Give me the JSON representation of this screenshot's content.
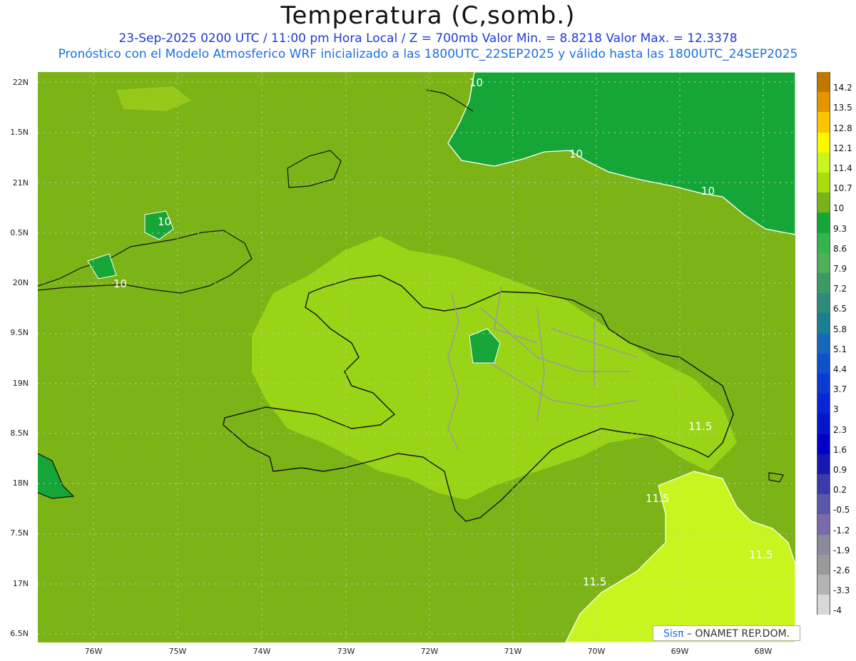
{
  "header": {
    "title": "Temperatura (C,somb.)",
    "line1": "23-Sep-2025  0200 UTC / 11:00 pm Hora Local / Z = 700mb    Valor Min. = 8.8218  Valor Max. = 12.3378",
    "line2": "Pronóstico con el Modelo Atmosferico WRF inicializado a las 1800UTC_22SEP2025 y válido hasta las  1800UTC_24SEP2025"
  },
  "axes": {
    "lat_labels": [
      "22N",
      "1.5N",
      "21N",
      "0.5N",
      "20N",
      "9.5N",
      "19N",
      "8.5N",
      "18N",
      "7.5N",
      "17N",
      "6.5N"
    ],
    "lon_labels": [
      "76W",
      "75W",
      "74W",
      "73W",
      "72W",
      "71W",
      "70W",
      "69W",
      "68W"
    ]
  },
  "contour_labels": [
    "10",
    "10",
    "10",
    "10",
    "10",
    "11.5",
    "11.5",
    "11.5",
    "11.5"
  ],
  "colorbar": {
    "levels": [
      "14.2",
      "13.5",
      "12.8",
      "12.1",
      "11.4",
      "10.7",
      "10",
      "9.3",
      "8.6",
      "7.9",
      "7.2",
      "6.5",
      "5.8",
      "5.1",
      "4.4",
      "3.7",
      "3",
      "2.3",
      "1.6",
      "0.9",
      "0.2",
      "-0.5",
      "-1.2",
      "-1.9",
      "-2.6",
      "-3.3",
      "-4"
    ],
    "colors": [
      "#c07800",
      "#e69500",
      "#ffc400",
      "#fff700",
      "#c8f51e",
      "#a6dd0a",
      "#78b417",
      "#16a637",
      "#33b54a",
      "#4fb05a",
      "#3b9b66",
      "#2e8a7a",
      "#1a7f95",
      "#1567b8",
      "#1050c8",
      "#0a3ad2",
      "#0826d8",
      "#0515cc",
      "#0000c8",
      "#1717b4",
      "#3a3aaa",
      "#5858a8",
      "#7a6aa8",
      "#8a8a9a",
      "#9a9a9a",
      "#b4b4b4",
      "#d8d8d8"
    ]
  },
  "legend_colors": {
    "sea_base": "#7cb417",
    "dark_green": "#16a637",
    "light_green": "#a6dd0a",
    "yellow_green": "#c8f51e"
  },
  "credit": {
    "brand": "Sisπ",
    "text": "– ONAMET REP.DOM."
  }
}
